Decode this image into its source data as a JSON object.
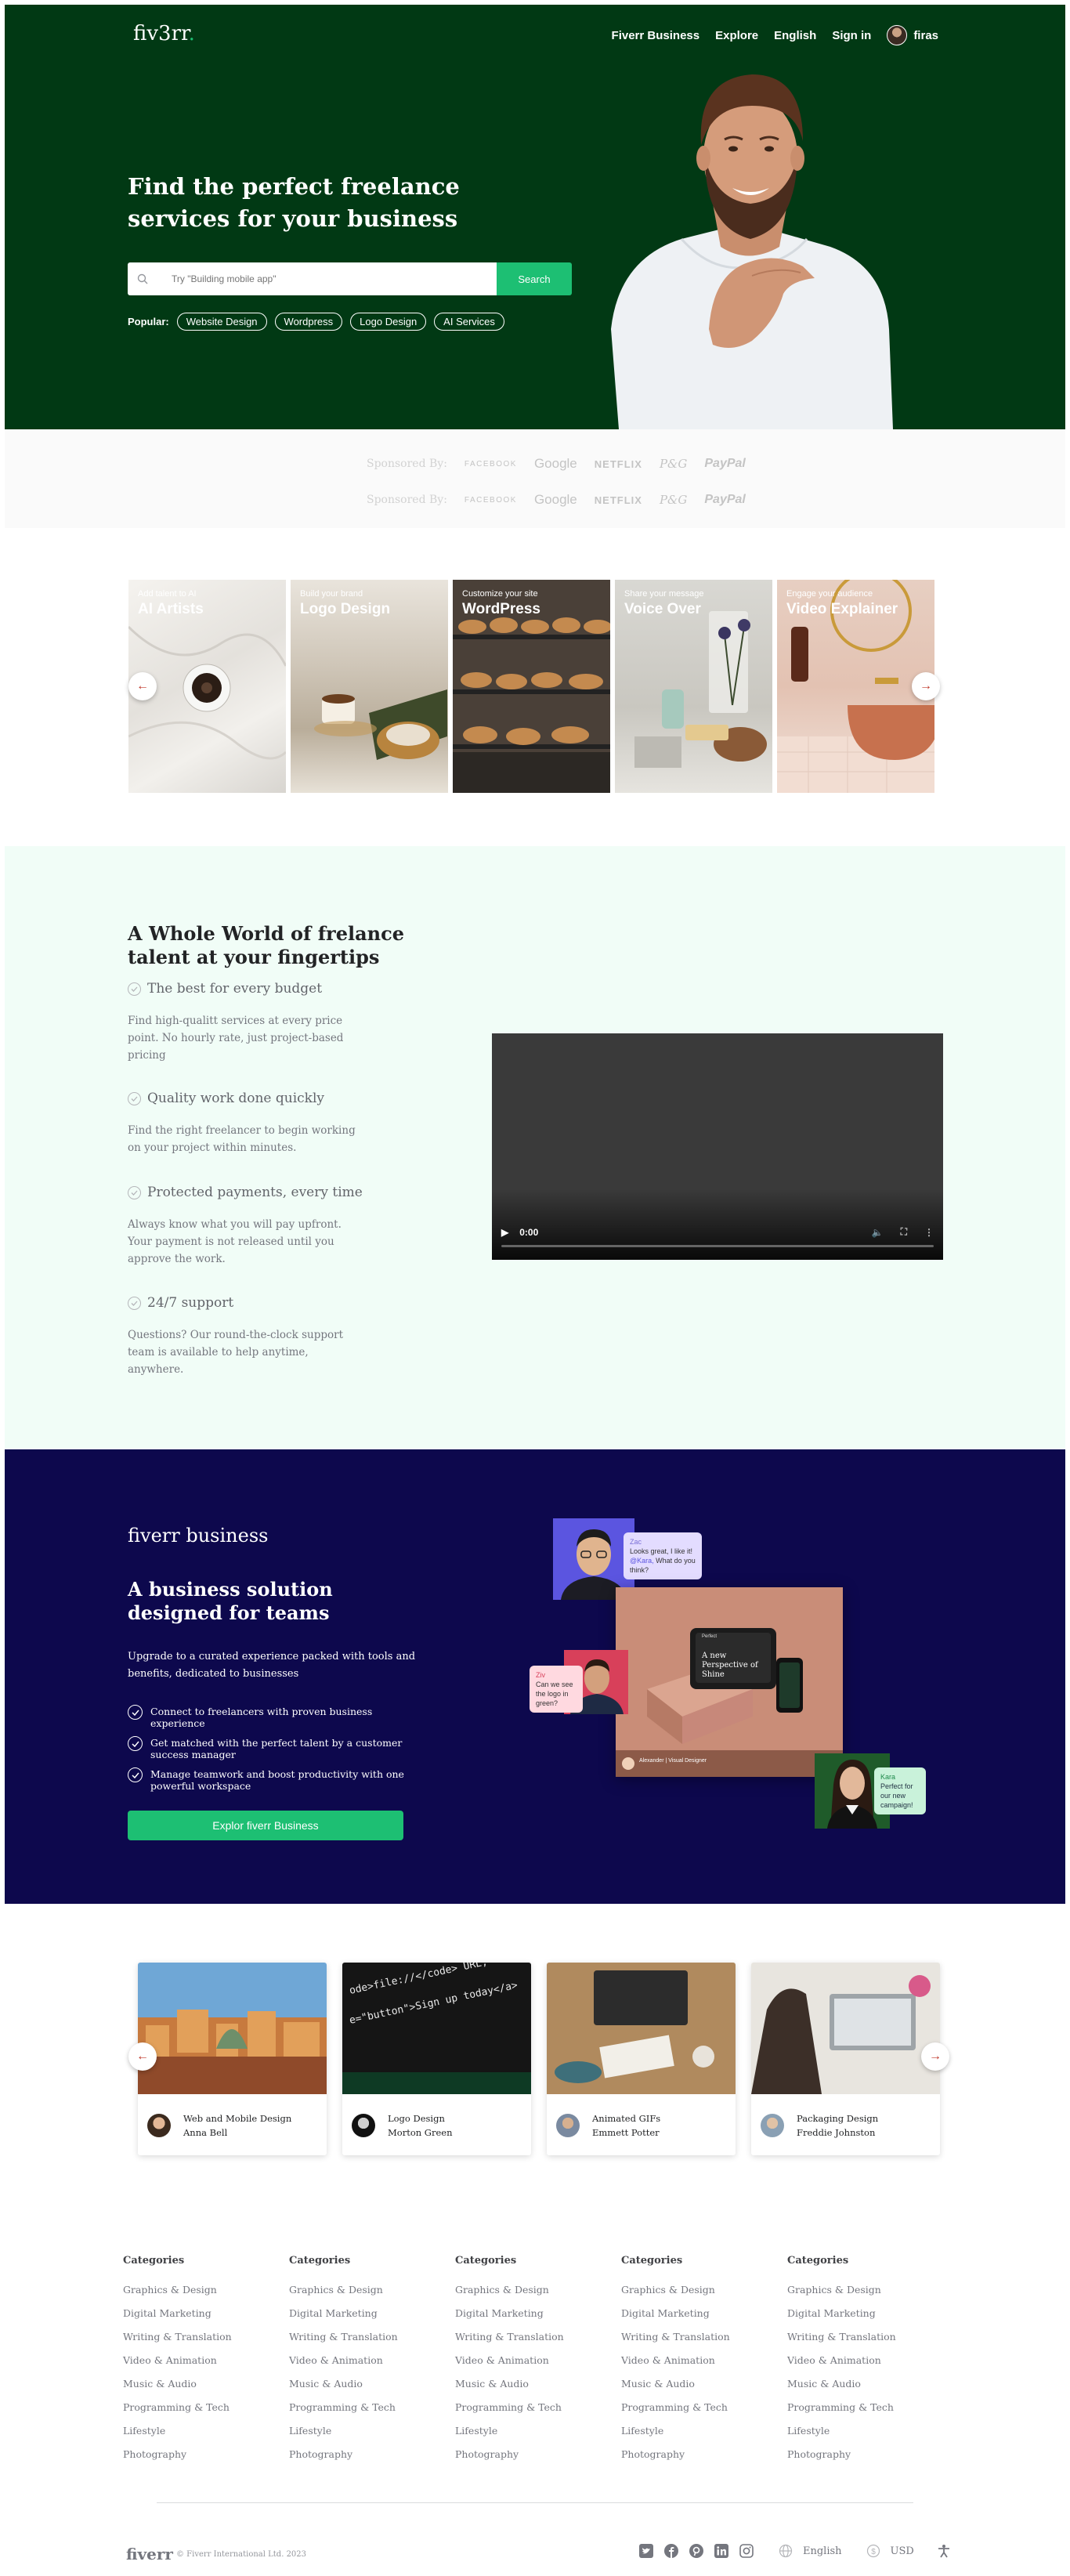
{
  "nav": {
    "logo": "fiv3rr",
    "logo_dot": ".",
    "links": [
      "Fiverr Business",
      "Explore",
      "English",
      "Sign in"
    ],
    "username": "firas"
  },
  "hero": {
    "title": "Find the perfect freelance services for your business",
    "search_placeholder": "Try \"Building mobile app\"",
    "search_button": "Search",
    "popular_label": "Popular:",
    "popular_tags": [
      "Website Design",
      "Wordpress",
      "Logo Design",
      "AI Services"
    ]
  },
  "sponsors": {
    "label": "Sponsored By:",
    "brands": [
      "FACEBOOK",
      "Google",
      "NETFLIX",
      "P&G",
      "PayPal"
    ]
  },
  "categories": [
    {
      "subtitle": "Add talent to AI",
      "title": "AI Artists"
    },
    {
      "subtitle": "Build your brand",
      "title": "Logo Design"
    },
    {
      "subtitle": "Customize your site",
      "title": "WordPress"
    },
    {
      "subtitle": "Share your message",
      "title": "Voice Over"
    },
    {
      "subtitle": "Engage your audience",
      "title": "Video Explainer"
    }
  ],
  "features": {
    "title": "A Whole World of frelance talent at your fingertips",
    "items": [
      {
        "title": "The best for every budget",
        "desc": "Find high-qualitt services at every price point. No hourly rate, just project-based pricing"
      },
      {
        "title": "Quality work done quickly",
        "desc": "Find the right freelancer to begin working on your project within minutes."
      },
      {
        "title": "Protected payments, every time",
        "desc": "Always know what you will pay upfront. Your payment is not released until you approve the work."
      },
      {
        "title": "24/7 support",
        "desc": "Questions? Our round-the-clock support team is available to help anytime, anywhere."
      }
    ],
    "video_time": "0:00"
  },
  "business": {
    "logo": "fiverr business",
    "title": "A business solution designed for teams",
    "description": "Upgrade to a curated experience packed with tools and benefits, dedicated to businesses",
    "points": [
      "Connect to freelancers with proven business experience",
      "Get matched with the perfect talent by a customer success manager",
      "Manage teamwork and boost productivity with one powerful workspace"
    ],
    "button": "Explor fiverr Business",
    "chat_1_name": "Zac",
    "chat_1_text": "Looks great, I like it!",
    "chat_1_sub": "What do you think?",
    "chat_1_mention": "@Kara,",
    "chat_2_name": "Ziv",
    "chat_2_text": "Can we see the logo in green?",
    "chat_3_name": "Kara",
    "chat_3_text": "Perfect for our new campaign!",
    "mockup_title": "A new Perspective of Shine",
    "mockup_brand": "Perfect",
    "credit": "Alexander | Visual Designer"
  },
  "projects": [
    {
      "category": "Web and Mobile Design",
      "name": "Anna Bell"
    },
    {
      "category": "Logo Design",
      "name": "Morton Green"
    },
    {
      "category": "Animated GIFs",
      "name": "Emmett Potter"
    },
    {
      "category": "Packaging Design",
      "name": "Freddie Johnston"
    }
  ],
  "footer": {
    "columns": [
      {
        "heading": "Categories",
        "links": [
          "Graphics & Design",
          "Digital Marketing",
          "Writing & Translation",
          "Video & Animation",
          "Music & Audio",
          "Programming & Tech",
          "Lifestyle",
          "Photography"
        ]
      },
      {
        "heading": "Categories",
        "links": [
          "Graphics & Design",
          "Digital Marketing",
          "Writing & Translation",
          "Video & Animation",
          "Music & Audio",
          "Programming & Tech",
          "Lifestyle",
          "Photography"
        ]
      },
      {
        "heading": "Categories",
        "links": [
          "Graphics & Design",
          "Digital Marketing",
          "Writing & Translation",
          "Video & Animation",
          "Music & Audio",
          "Programming & Tech",
          "Lifestyle",
          "Photography"
        ]
      },
      {
        "heading": "Categories",
        "links": [
          "Graphics & Design",
          "Digital Marketing",
          "Writing & Translation",
          "Video & Animation",
          "Music & Audio",
          "Programming & Tech",
          "Lifestyle",
          "Photography"
        ]
      },
      {
        "heading": "Categories",
        "links": [
          "Graphics & Design",
          "Digital Marketing",
          "Writing & Translation",
          "Video & Animation",
          "Music & Audio",
          "Programming & Tech",
          "Lifestyle",
          "Photography"
        ]
      }
    ],
    "logo": "fiverr",
    "copyright": "© Fiverr International Ltd. 2023",
    "language": "English",
    "currency": "USD",
    "icons": [
      "twitter-icon",
      "facebook-icon",
      "pinterest-icon",
      "linkedin-icon",
      "instagram-icon"
    ]
  },
  "colors": {
    "hero_bg": "#013914",
    "accent_green": "#1dbf73",
    "features_bg": "#f1fdf7",
    "business_bg": "#0d084d"
  }
}
